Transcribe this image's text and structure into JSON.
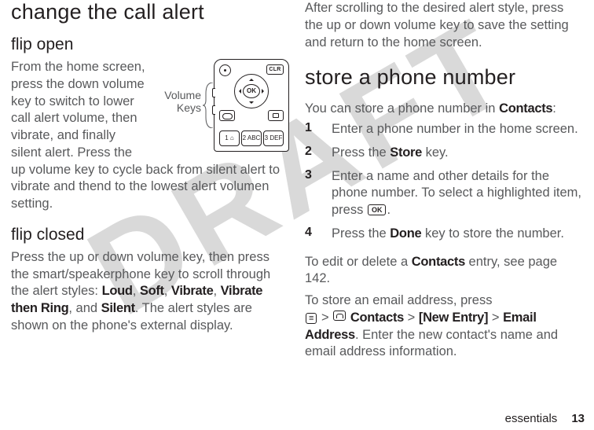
{
  "watermark": "DRAFT",
  "left": {
    "heading": "change the call alert",
    "flip_open": {
      "title": "flip open",
      "label_volume": "Volume",
      "label_keys": "Keys",
      "body": "From the home screen, press the down volume key to switch to lower call alert volume, then vibrate, and finally silent alert. Press the up volume key to cycle back from silent alert to vibrate and thend to the lowest alert volumen setting."
    },
    "flip_closed": {
      "title": "flip closed",
      "body_pre": "Press the up or down volume key, then press the smart/speakerphone key to scroll through the alert styles: ",
      "styles": [
        "Loud",
        "Soft",
        "Vibrate",
        "Vibrate then Ring",
        "Silent"
      ],
      "body_post": ". The alert styles are shown on the phone's external display."
    },
    "phone_illustration": {
      "ok": "OK",
      "clr": "CLR",
      "keys": [
        "1 ⌂",
        "2 ABC",
        "3 DEF"
      ]
    }
  },
  "right": {
    "intro": "After scrolling to the desired alert style, press the up or down volume key to save the setting and return to the home screen.",
    "heading": "store a phone number",
    "lead_pre": "You can store a phone number in ",
    "lead_bold": "Contacts",
    "lead_post": ":",
    "steps": [
      {
        "n": "1",
        "text": "Enter a phone number in the home screen."
      },
      {
        "n": "2",
        "pre": "Press the ",
        "bold": "Store",
        "post": " key."
      },
      {
        "n": "3",
        "pre": "Enter a name and other details for the phone number. To select a highlighted item, press ",
        "btn": "OK",
        "post": "."
      },
      {
        "n": "4",
        "pre": "Press the ",
        "bold": "Done",
        "post": " key to store the number."
      }
    ],
    "edit_pre": "To edit or delete a ",
    "edit_bold": "Contacts",
    "edit_post": " entry, see page 142.",
    "email_pre": "To store an email address, press",
    "email_path": {
      "menu": "≡",
      "sep": ">",
      "p1_icon": "☎",
      "p1": "Contacts",
      "p2": "[New Entry]",
      "p3": "Email Address"
    },
    "email_post": "Enter the new contact's name and email address information."
  },
  "footer": {
    "section": "essentials",
    "page": "13"
  }
}
